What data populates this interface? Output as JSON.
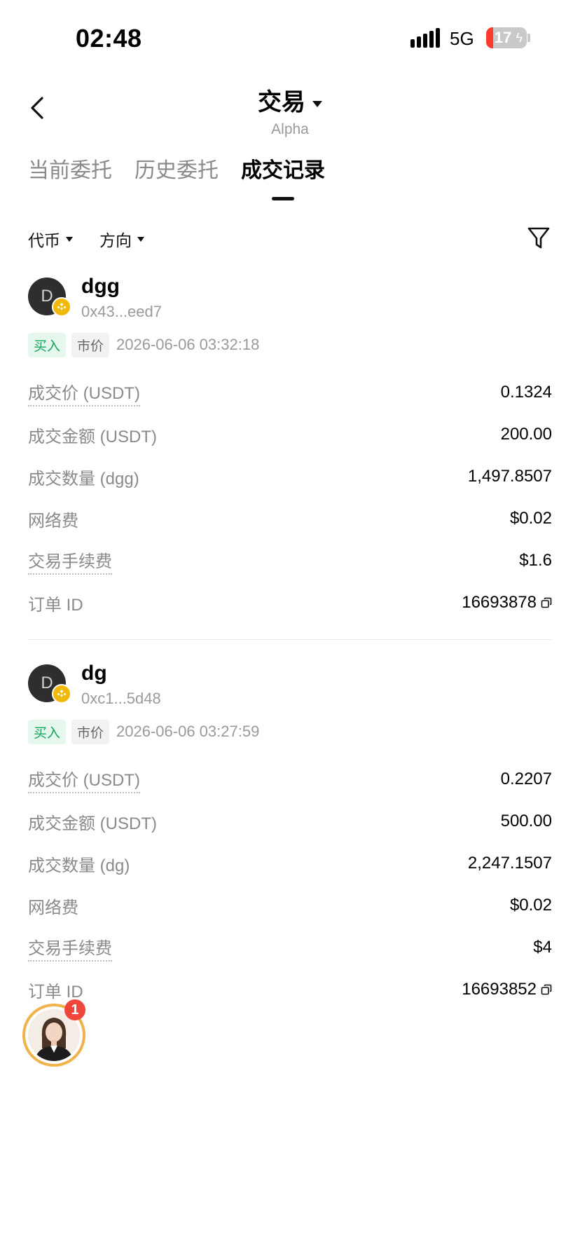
{
  "status_bar": {
    "time": "02:48",
    "network": "5G",
    "battery": "17",
    "battery_level": 0.17
  },
  "header": {
    "title": "交易",
    "subtitle": "Alpha"
  },
  "tabs": [
    {
      "label": "当前委托",
      "active": false
    },
    {
      "label": "历史委托",
      "active": false
    },
    {
      "label": "成交记录",
      "active": true
    }
  ],
  "filters": {
    "token": "代币",
    "direction": "方向"
  },
  "records": [
    {
      "avatar_letter": "D",
      "token": "dgg",
      "address": "0x43...eed7",
      "side": "买入",
      "order_type": "市价",
      "time": "2026-06-06 03:32:18",
      "rows": [
        {
          "label": "成交价 (USDT)",
          "value": "0.1324"
        },
        {
          "label": "成交金额 (USDT)",
          "value": "200.00"
        },
        {
          "label": "成交数量 (dgg)",
          "value": "1,497.8507"
        },
        {
          "label": "网络费",
          "value": "$0.02"
        },
        {
          "label": "交易手续费",
          "value": "$1.6"
        },
        {
          "label": "订单 ID",
          "value": "16693878"
        }
      ]
    },
    {
      "avatar_letter": "D",
      "token": "dg",
      "address": "0xc1...5d48",
      "side": "买入",
      "order_type": "市价",
      "time": "2026-06-06 03:27:59",
      "rows": [
        {
          "label": "成交价 (USDT)",
          "value": "0.2207"
        },
        {
          "label": "成交金额 (USDT)",
          "value": "500.00"
        },
        {
          "label": "成交数量 (dg)",
          "value": "2,247.1507"
        },
        {
          "label": "网络费",
          "value": "$0.02"
        },
        {
          "label": "交易手续费",
          "value": "$4"
        },
        {
          "label": "订单 ID",
          "value": "16693852"
        }
      ]
    }
  ],
  "support": {
    "badge": "1"
  },
  "colors": {
    "buy": "#17a35a",
    "buy_bg": "#e6f7ee",
    "battery_low": "#ff3b30",
    "support_ring": "#f0b24a",
    "chain_badge": "#f0b90b"
  }
}
